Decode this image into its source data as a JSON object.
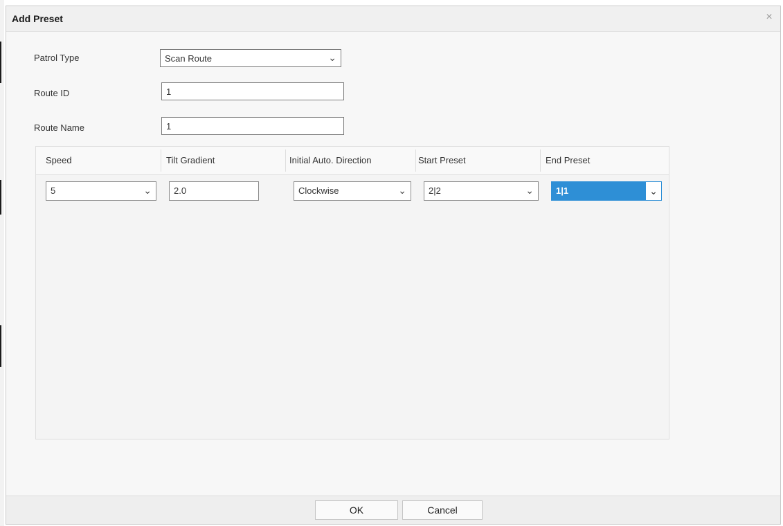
{
  "dialog": {
    "title": "Add Preset",
    "close_label": "×"
  },
  "form": {
    "preset_type": {
      "label": "Patrol Type",
      "value": "Scan Route"
    },
    "route_id": {
      "label": "Route ID",
      "value": "1"
    },
    "route_name": {
      "label": "Route Name",
      "value": "1"
    }
  },
  "table": {
    "columns": [
      "Speed",
      "Tilt Gradient",
      "Initial Auto. Direction",
      "Start Preset",
      "End Preset"
    ],
    "row": {
      "speed": "5",
      "tilt_gradient": "2.0",
      "direction": "Clockwise",
      "start_preset": "2|2",
      "end_preset": "1|1"
    }
  },
  "footer": {
    "ok_label": "OK",
    "cancel_label": "Cancel"
  },
  "icons": {
    "chevron": "⌵",
    "close": "close-icon"
  },
  "colors": {
    "highlight": "#2e8fd6"
  }
}
